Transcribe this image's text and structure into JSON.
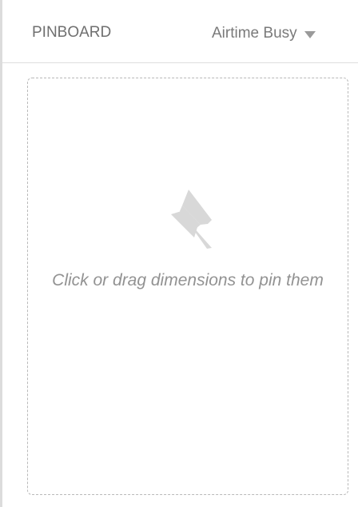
{
  "pinboard": {
    "title": "PINBOARD",
    "measure_selector": {
      "value": "Airtime Busy",
      "icon": "caret-down-icon"
    },
    "empty_state": {
      "icon": "pin-icon",
      "message": "Click or drag dimensions to pin them"
    }
  },
  "colors": {
    "title_text": "#6f6f6f",
    "selector_text": "#7a7a7a",
    "message_text": "#929292",
    "pin_icon": "#d8d8d8",
    "dashed_border": "#b9b9b9",
    "panel_divider": "#dcdcdc"
  }
}
